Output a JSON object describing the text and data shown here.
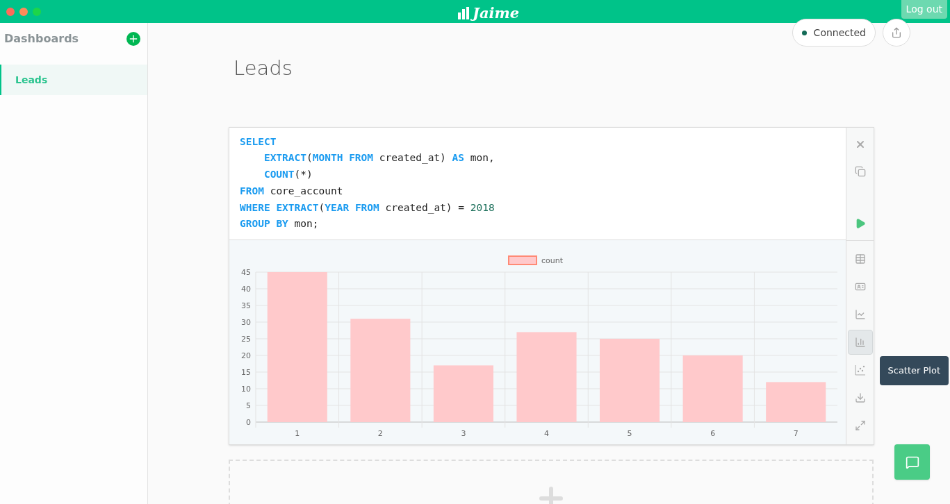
{
  "window": {
    "logo": "Jaime",
    "logout": "Log out"
  },
  "sidebar": {
    "title": "Dashboards",
    "items": [
      {
        "label": "Leads",
        "selected": true
      }
    ]
  },
  "header": {
    "status": "Connected"
  },
  "dashboard": {
    "title": "Leads"
  },
  "query": {
    "lines": [
      [
        {
          "kind": "kw",
          "text": "SELECT"
        }
      ],
      [
        {
          "kind": "indent"
        },
        {
          "kind": "kw",
          "text": "EXTRACT"
        },
        {
          "kind": "plain",
          "text": "("
        },
        {
          "kind": "kw",
          "text": "MONTH FROM"
        },
        {
          "kind": "plain",
          "text": " created_at) "
        },
        {
          "kind": "kw",
          "text": "AS"
        },
        {
          "kind": "plain",
          "text": " mon,"
        }
      ],
      [
        {
          "kind": "indent"
        },
        {
          "kind": "kw",
          "text": "COUNT"
        },
        {
          "kind": "plain",
          "text": "(*)"
        }
      ],
      [
        {
          "kind": "kw",
          "text": "FROM"
        },
        {
          "kind": "plain",
          "text": " core_account"
        }
      ],
      [
        {
          "kind": "kw",
          "text": "WHERE EXTRACT"
        },
        {
          "kind": "plain",
          "text": "("
        },
        {
          "kind": "kw",
          "text": "YEAR FROM"
        },
        {
          "kind": "plain",
          "text": " created_at) = "
        },
        {
          "kind": "num",
          "text": "2018"
        }
      ],
      [
        {
          "kind": "kw",
          "text": "GROUP BY"
        },
        {
          "kind": "plain",
          "text": " mon;"
        }
      ]
    ]
  },
  "views": [
    {
      "kind": "table",
      "selected": false
    },
    {
      "kind": "card",
      "selected": false
    },
    {
      "kind": "line",
      "selected": false
    },
    {
      "kind": "bar",
      "selected": true
    },
    {
      "kind": "scatter",
      "selected": false,
      "tooltip": "Scatter Plot"
    },
    {
      "kind": "download",
      "selected": false
    },
    {
      "kind": "expand",
      "selected": false
    }
  ],
  "chart": {
    "chart_data": {
      "type": "bar",
      "grid": true,
      "categories": [
        "1",
        "2",
        "3",
        "4",
        "5",
        "6",
        "7"
      ],
      "series": [
        {
          "name": "count",
          "color": "#ffc9cb",
          "values": [
            45,
            31,
            17,
            27,
            25,
            20,
            12
          ]
        }
      ],
      "ylim": [
        0,
        45
      ],
      "yticks": [
        0,
        5,
        10,
        15,
        20,
        25,
        30,
        35,
        40,
        45
      ]
    }
  }
}
